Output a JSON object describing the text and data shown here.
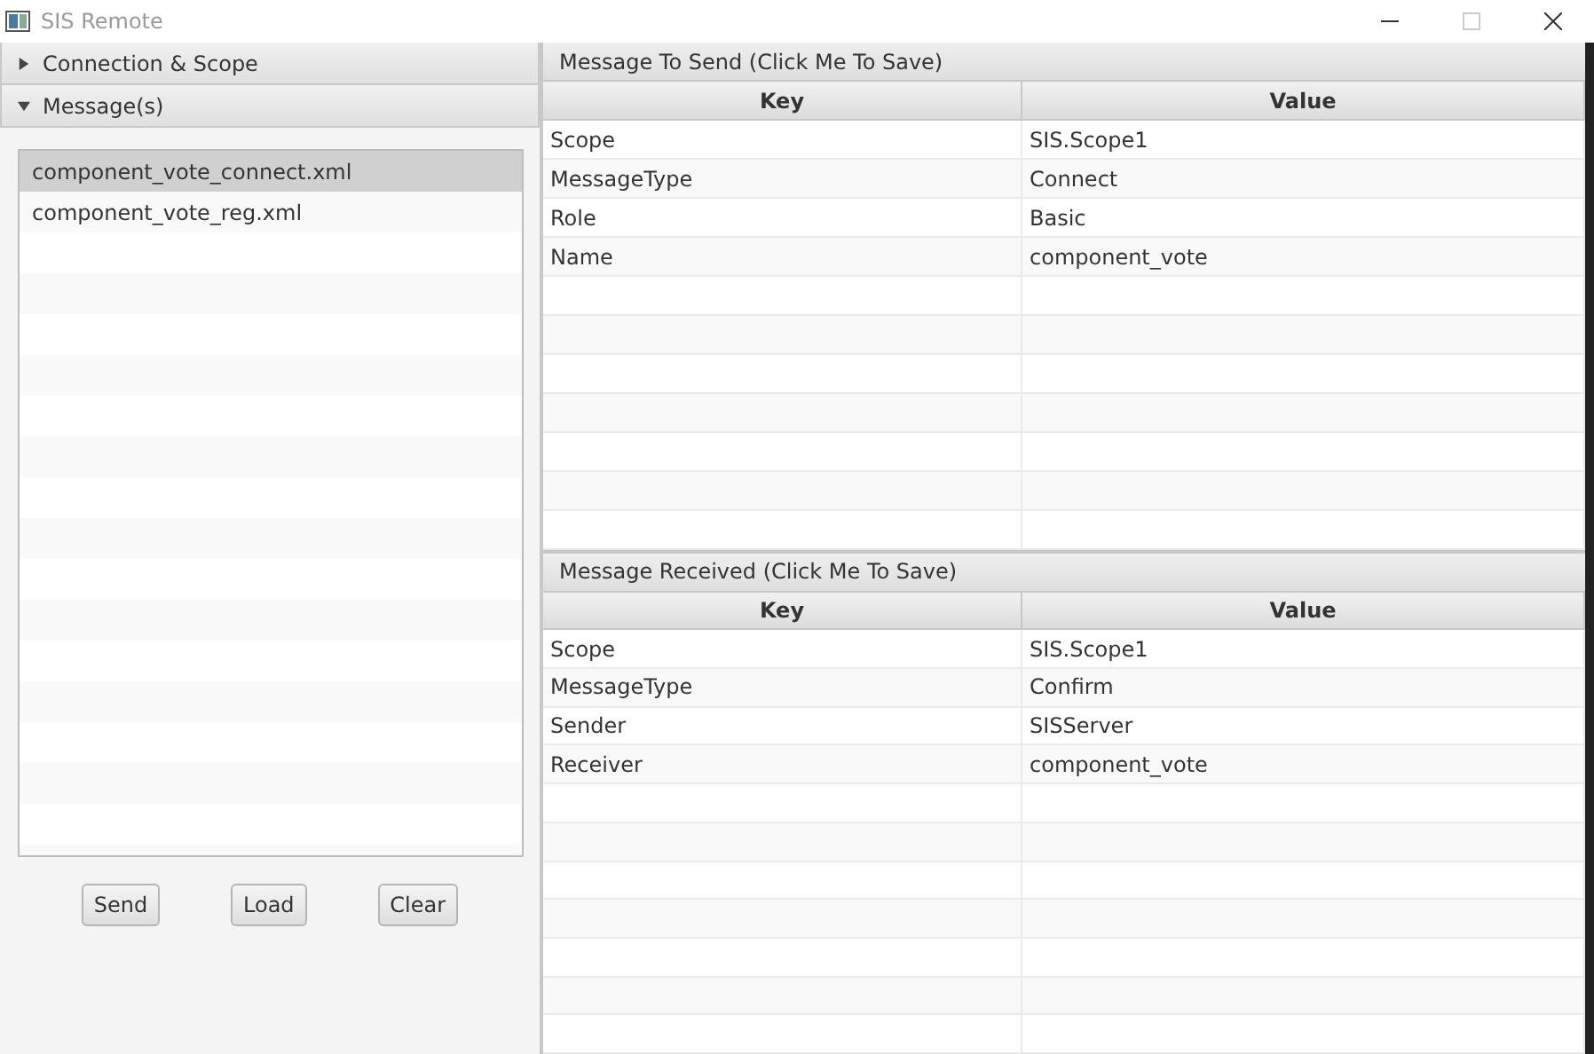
{
  "window": {
    "title": "SIS Remote"
  },
  "accordion": [
    {
      "label": "Connection & Scope",
      "expanded": false
    },
    {
      "label": "Message(s)",
      "expanded": true
    }
  ],
  "messages": [
    {
      "label": "component_vote_connect.xml",
      "selected": true
    },
    {
      "label": "component_vote_reg.xml",
      "selected": false
    }
  ],
  "buttons": [
    "Send",
    "Load",
    "Clear"
  ],
  "tables": [
    {
      "title": "Message To Send (Click Me To Save)",
      "columns": [
        "Key",
        "Value"
      ],
      "rows": [
        [
          "Scope",
          "SIS.Scope1"
        ],
        [
          "MessageType",
          "Connect"
        ],
        [
          "Role",
          "Basic"
        ],
        [
          "Name",
          "component_vote"
        ]
      ]
    },
    {
      "title": "Message Received (Click Me To Save)",
      "columns": [
        "Key",
        "Value"
      ],
      "rows": [
        [
          "Scope",
          "SIS.Scope1"
        ],
        [
          "MessageType",
          "Confirm"
        ],
        [
          "Sender",
          "SISServer"
        ],
        [
          "Receiver",
          "component_vote"
        ]
      ]
    }
  ]
}
